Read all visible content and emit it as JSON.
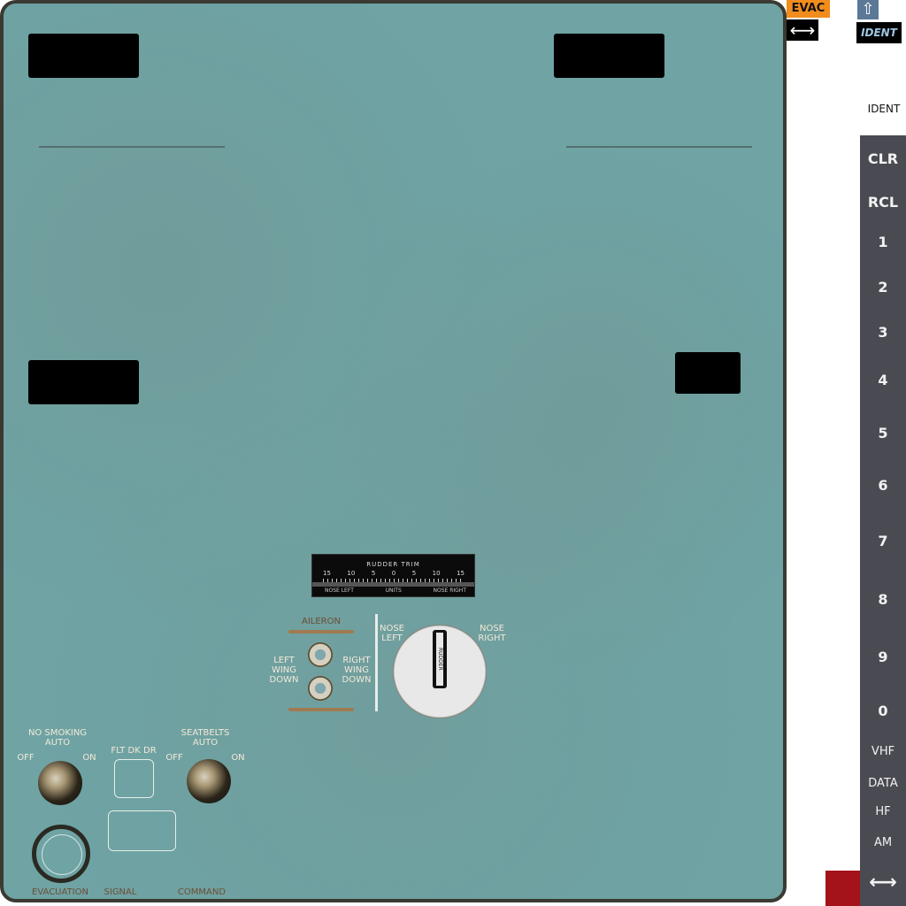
{
  "panel": {
    "rudder_trim": {
      "title": "RUDDER TRIM",
      "scale": [
        "15",
        "10",
        "5",
        "0",
        "5",
        "10",
        "15"
      ],
      "footer": [
        "NOSE LEFT",
        "UNITS",
        "NOSE RIGHT"
      ]
    },
    "aileron_label": "AILERON",
    "left_wing_down": "LEFT\nWING\nDOWN",
    "right_wing_down": "RIGHT\nWING\nDOWN",
    "nose_left": "NOSE\nLEFT",
    "nose_right": "NOSE\nRIGHT",
    "rudder_label": "RUDDER",
    "no_smoking": "NO SMOKING\nAUTO",
    "seatbelts": "SEATBELTS\nAUTO",
    "off": "OFF",
    "on": "ON",
    "flt_dk_dr": "FLT DK DR",
    "evacuation": "EVACUATION",
    "signal": "SIGNAL",
    "command": "COMMAND"
  },
  "side": {
    "evac": "EVAC",
    "evac_arrow": "⟷",
    "up_arrow": "⇧",
    "ident_button": "IDENT",
    "ident_label": "IDENT",
    "keys": [
      "CLR",
      "RCL",
      "1",
      "2",
      "3",
      "4",
      "5",
      "6",
      "7",
      "8",
      "9",
      "0",
      "VHF",
      "DATA",
      "HF",
      "AM"
    ],
    "bottom_arrow": "⟷"
  },
  "colors": {
    "panel": "#6fa3a4",
    "evac": "#f28c1c",
    "keypad": "#4a4a52",
    "red_box": "#a4121a"
  }
}
